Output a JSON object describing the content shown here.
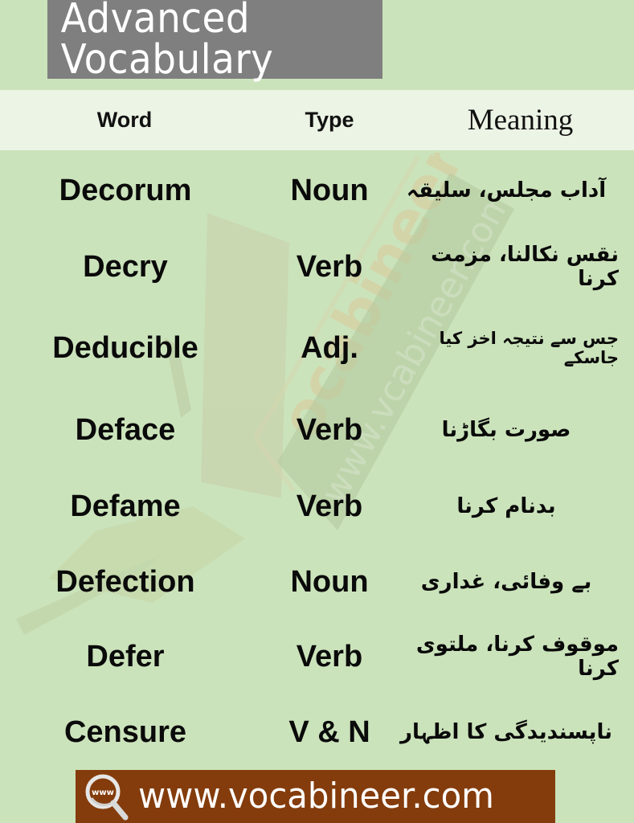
{
  "title": "Advanced Vocabulary",
  "header": {
    "word": "Word",
    "type": "Type",
    "meaning": "Meaning"
  },
  "rows": [
    {
      "word": "Decorum",
      "type": "Noun",
      "meaning": "آداب مجلس، سلیقہ"
    },
    {
      "word": "Decry",
      "type": "Verb",
      "meaning": "نقس نکالنا، مزمت کرنا"
    },
    {
      "word": "Deducible",
      "type": "Adj.",
      "meaning": "جس سے نتیجہ اخز کیا جاسکے"
    },
    {
      "word": "Deface",
      "type": "Verb",
      "meaning": "صورت بگاڑنا"
    },
    {
      "word": "Defame",
      "type": "Verb",
      "meaning": "بدنام کرنا"
    },
    {
      "word": "Defection",
      "type": "Noun",
      "meaning": "بے وفائی، غداری"
    },
    {
      "word": "Defer",
      "type": "Verb",
      "meaning": "موقوف کرنا، ملتوی کرنا"
    },
    {
      "word": "Censure",
      "type": "V & N",
      "meaning": "ناپسندیدگی کا اظہار"
    }
  ],
  "watermark": {
    "brand": "vocabineer",
    "url": "www.vcabineer.com"
  },
  "footer": {
    "icon": "www-magnifier-icon",
    "icon_label": "www",
    "url": "www.vocabineer.com"
  },
  "colors": {
    "background": "#cbe3bb",
    "title_bar": "#7f7f7f",
    "header_row": "#ecf4e5",
    "footer_bar": "#843c0c"
  }
}
